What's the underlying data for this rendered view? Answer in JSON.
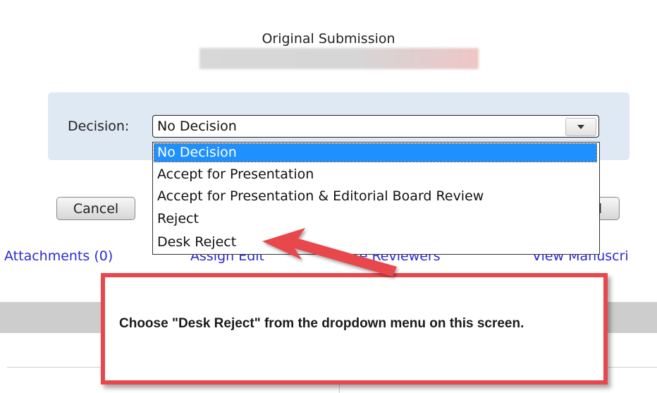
{
  "header": {
    "title": "Original Submission"
  },
  "decision": {
    "label": "Decision:",
    "selected_value": "No Decision",
    "options": [
      "No Decision",
      "Accept for Presentation",
      "Accept for Presentation & Editorial Board Review",
      "Reject",
      "Desk Reject"
    ]
  },
  "buttons": {
    "cancel": "Cancel",
    "right_partial": "d"
  },
  "links": {
    "attachments": "Attachments (0)",
    "assign_partial": "Assign Edit",
    "invite_partial": "ite Reviewers",
    "view_partial": "View Manuscri"
  },
  "callout": {
    "text": "Choose \"Desk Reject\" from the dropdown menu on this screen.",
    "border_color": "#e8474c"
  },
  "colors": {
    "panel": "#dfe9f4",
    "link": "#2a2ad6",
    "selection": "#1e90ff"
  }
}
